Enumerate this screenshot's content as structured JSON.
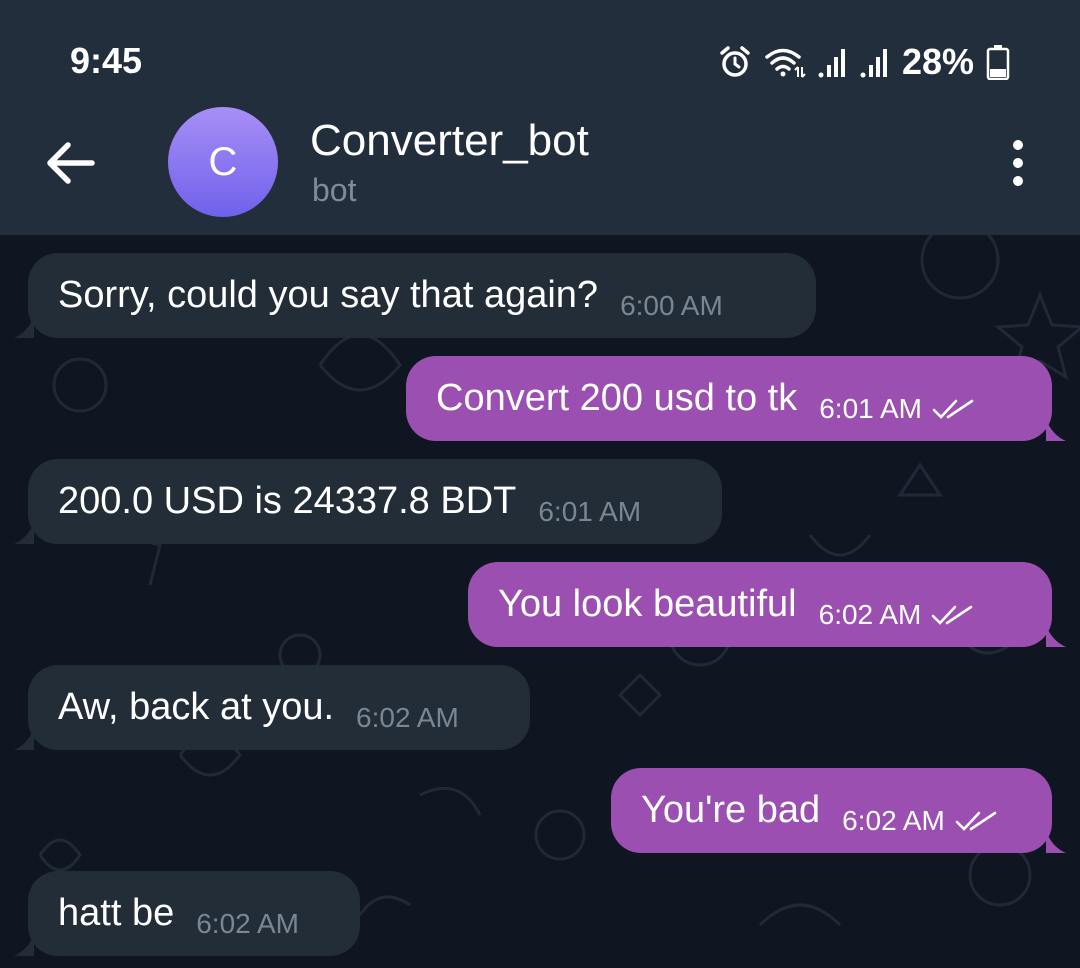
{
  "status_bar": {
    "time": "9:45",
    "battery": "28%",
    "icons": [
      "alarm-icon",
      "wifi-icon",
      "signal-icon",
      "signal-icon",
      "battery-icon"
    ]
  },
  "header": {
    "back_icon": "back-arrow-icon",
    "avatar_letter": "C",
    "title": "Converter_bot",
    "subtitle": "bot",
    "menu_icon": "more-vertical-icon"
  },
  "colors": {
    "header_bg": "#232e3c",
    "chat_bg": "#0f1621",
    "incoming_bubble": "#222d38",
    "outgoing_bubble": "#9b4fb0",
    "avatar_top": "#a88ff7",
    "avatar_bottom": "#6f61ea"
  },
  "messages": [
    {
      "direction": "in",
      "text": "Sorry, could you say that again?",
      "time": "6:00 AM"
    },
    {
      "direction": "out",
      "text": "Convert 200 usd to tk",
      "time": "6:01 AM",
      "status": "read"
    },
    {
      "direction": "in",
      "text": "200.0 USD is 24337.8 BDT",
      "time": "6:01 AM"
    },
    {
      "direction": "out",
      "text": "You look beautiful",
      "time": "6:02 AM",
      "status": "read"
    },
    {
      "direction": "in",
      "text": "Aw, back at you.",
      "time": "6:02 AM"
    },
    {
      "direction": "out",
      "text": "You're bad",
      "time": "6:02 AM",
      "status": "read"
    },
    {
      "direction": "in",
      "text": "hatt be",
      "time": "6:02 AM"
    }
  ]
}
